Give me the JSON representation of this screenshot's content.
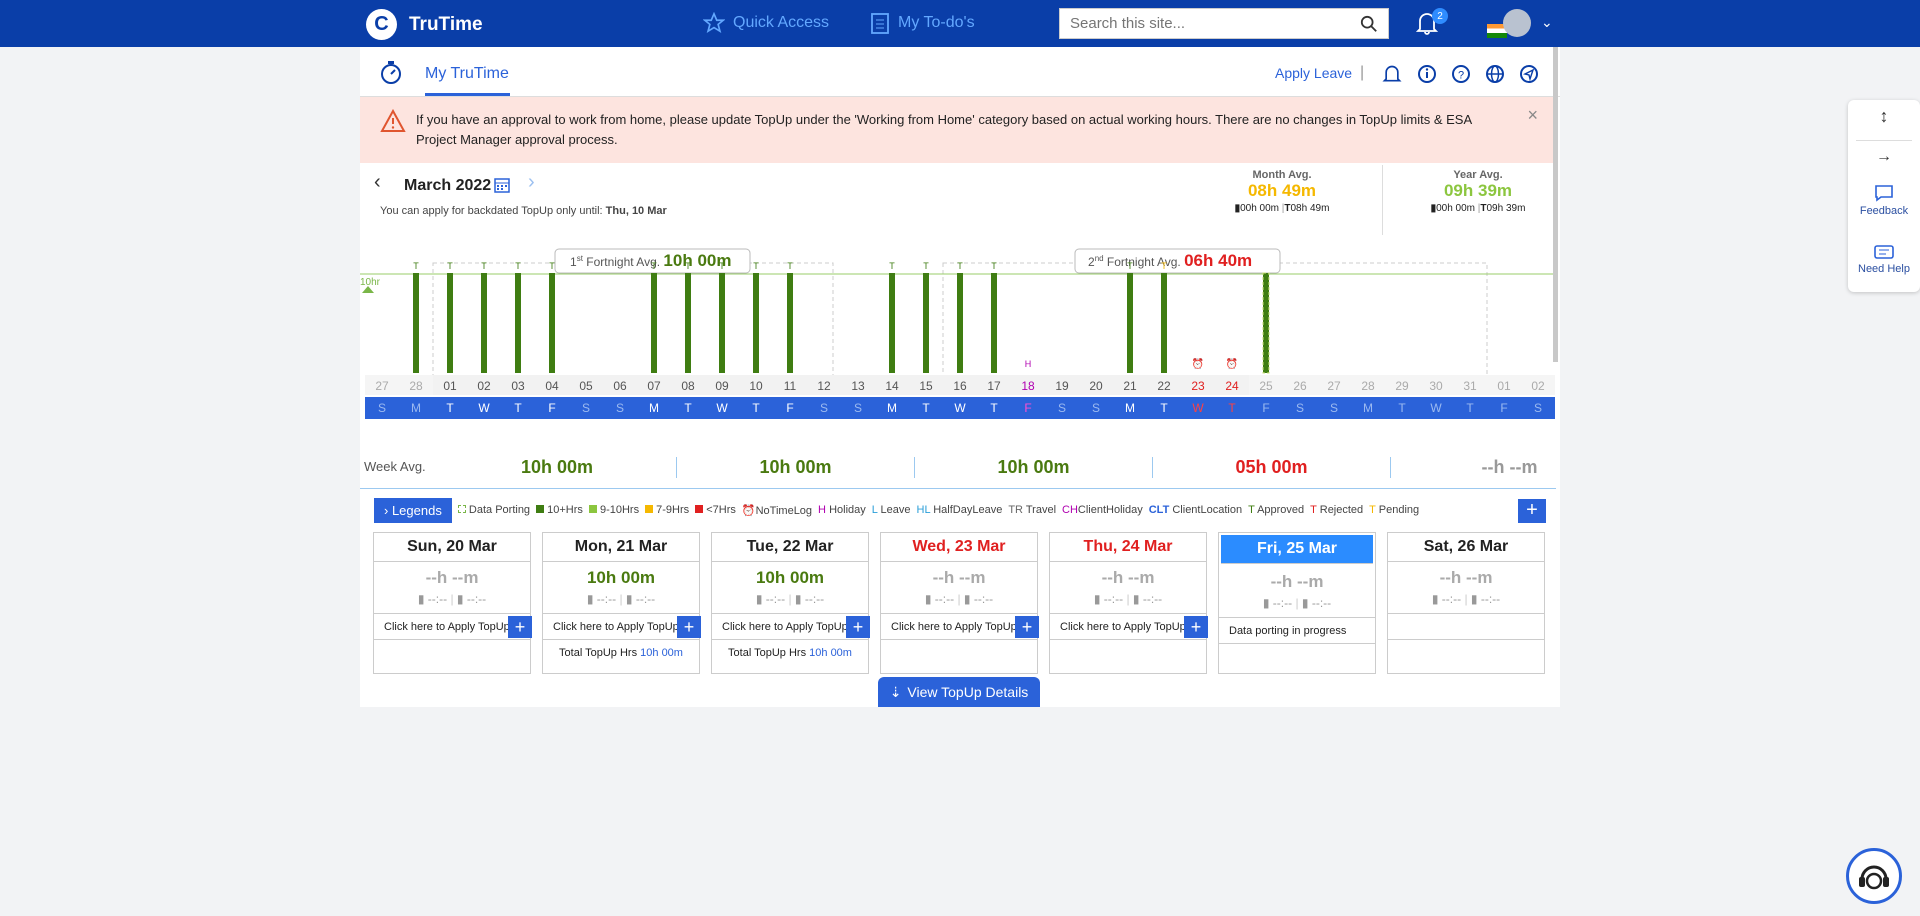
{
  "header": {
    "app": "TruTime",
    "logo_letter": "C",
    "quick_access": "Quick Access",
    "todos": "My To-do's",
    "search_placeholder": "Search this site...",
    "notif_count": "2"
  },
  "subnav": {
    "tab": "My TruTime",
    "apply_leave": "Apply Leave",
    "sep": "|"
  },
  "alert": {
    "text": "If you have an approval to work from home, please update TopUp under the 'Working from Home' category based on actual working hours. There are no changes in TopUp limits & ESA Project Manager approval process."
  },
  "month": {
    "label": "March 2022",
    "backdated_text": "You can apply for backdated TopUp only until:",
    "backdated_date": "Thu, 10 Mar",
    "month_avg_label": "Month Avg.",
    "month_avg": "08h 49m",
    "month_d": "00h 00m",
    "month_t": "08h 49m",
    "year_avg_label": "Year Avg.",
    "year_avg": "09h 39m",
    "year_d": "00h 00m",
    "year_t": "09h 39m"
  },
  "fortnight": {
    "f1_sup": "st",
    "f1_label": "Fortnight Avg.",
    "f1_num": "1",
    "f1": "10h 00m",
    "f2_sup": "nd",
    "f2_label": "Fortnight Avg.",
    "f2_num": "2",
    "f2": "06h 40m",
    "ref_label": "10hr"
  },
  "chart_data": {
    "type": "bar",
    "dates": [
      "27",
      "28",
      "01",
      "02",
      "03",
      "04",
      "05",
      "06",
      "07",
      "08",
      "09",
      "10",
      "11",
      "12",
      "13",
      "14",
      "15",
      "16",
      "17",
      "18",
      "19",
      "20",
      "21",
      "22",
      "23",
      "24",
      "25",
      "26",
      "27",
      "28",
      "29",
      "30",
      "31",
      "01",
      "02"
    ],
    "weekdays": [
      "S",
      "M",
      "T",
      "W",
      "T",
      "F",
      "S",
      "S",
      "M",
      "T",
      "W",
      "T",
      "F",
      "S",
      "S",
      "M",
      "T",
      "W",
      "T",
      "F",
      "S",
      "S",
      "M",
      "T",
      "W",
      "T",
      "F",
      "S",
      "S",
      "M",
      "T",
      "W",
      "T",
      "F",
      "S"
    ],
    "values": [
      0,
      10,
      10,
      10,
      10,
      10,
      0,
      0,
      10,
      10,
      10,
      10,
      10,
      0,
      0,
      10,
      10,
      10,
      10,
      0,
      0,
      0,
      10,
      10,
      0,
      0,
      10,
      0,
      0,
      0,
      0,
      0,
      0,
      0,
      0
    ],
    "markers": [
      "",
      "T",
      "T",
      "T",
      "T",
      "T",
      "",
      "",
      "T",
      "T",
      "T",
      "T",
      "T",
      "",
      "",
      "T",
      "T",
      "T",
      "T",
      "H",
      "",
      "",
      "T",
      "T",
      "⏰",
      "⏰",
      "",
      "",
      "",
      "",
      "",
      "",
      "",
      "",
      ""
    ],
    "ylim": [
      0,
      11
    ]
  },
  "week_avg": {
    "label": "Week Avg.",
    "values": [
      "10h 00m",
      "10h 00m",
      "10h 00m",
      "05h 00m",
      "--h --m"
    ]
  },
  "legends": {
    "button": "Legends",
    "items": [
      "Data Porting",
      "10+Hrs",
      "9-10Hrs",
      "7-9Hrs",
      "<7Hrs",
      "NoTimeLog",
      "Holiday",
      "Leave",
      "HalfDayLeave",
      "Travel",
      "ClientHoliday",
      "ClientLocation",
      "Approved",
      "Rejected",
      "Pending"
    ],
    "codes": [
      "",
      "",
      "",
      "",
      "",
      "",
      "H",
      "L",
      "HL",
      "TR",
      "CH",
      "CLT",
      "T",
      "T",
      "T"
    ]
  },
  "days": [
    {
      "title": "Sun, 20 Mar",
      "total": "--h --m",
      "apply": "Click here to Apply TopUp",
      "topup": ""
    },
    {
      "title": "Mon, 21 Mar",
      "total": "10h 00m",
      "apply": "Click here to Apply TopUp",
      "topup": "Total TopUp Hrs",
      "topup_val": "10h 00m"
    },
    {
      "title": "Tue, 22 Mar",
      "total": "10h 00m",
      "apply": "Click here to Apply TopUp",
      "topup": "Total TopUp Hrs",
      "topup_val": "10h 00m"
    },
    {
      "title": "Wed, 23 Mar",
      "total": "--h --m",
      "apply": "Click here to Apply TopUp",
      "topup": ""
    },
    {
      "title": "Thu, 24 Mar",
      "total": "--h --m",
      "apply": "Click here to Apply TopUp",
      "topup": ""
    },
    {
      "title": "Fri, 25 Mar",
      "total": "--h --m",
      "apply": "Data porting in progress",
      "topup": ""
    },
    {
      "title": "Sat, 26 Mar",
      "total": "--h --m",
      "apply": "",
      "topup": ""
    }
  ],
  "io_text": "--:--",
  "view_topup": "View TopUp Details",
  "side": {
    "feedback": "Feedback",
    "help": "Need Help"
  }
}
